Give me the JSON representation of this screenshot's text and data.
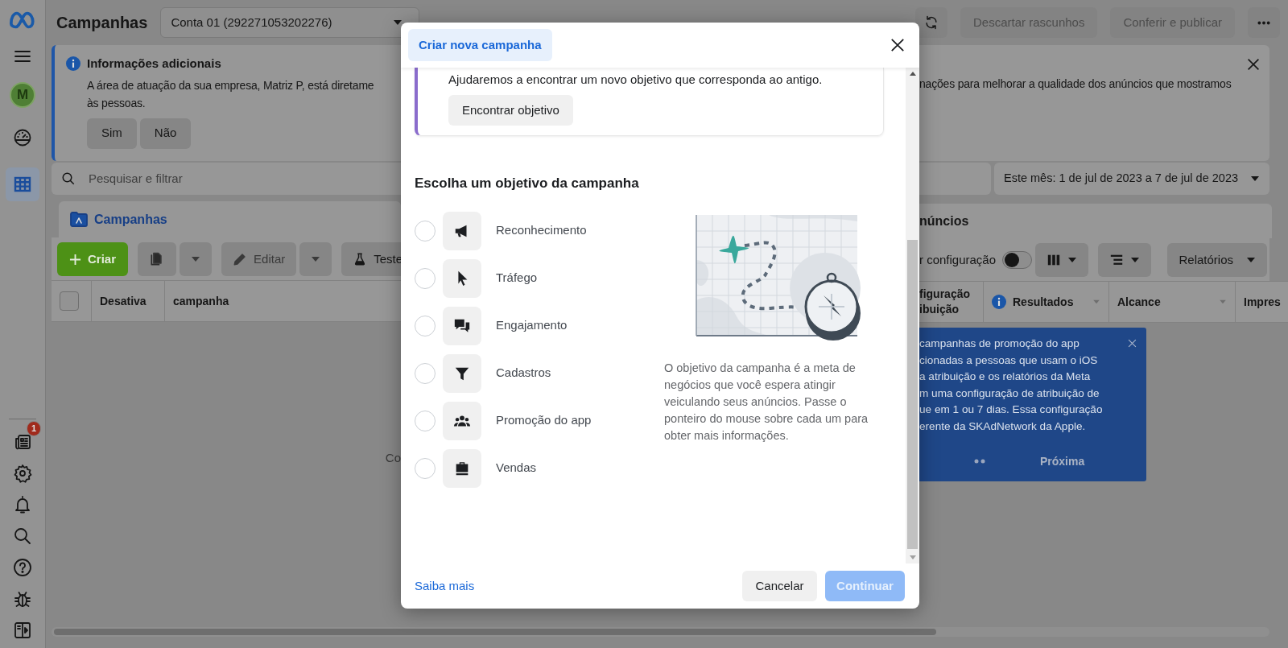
{
  "sidebar": {
    "avatar": "M",
    "nav": [
      {
        "kind": "gauge",
        "selected": false
      },
      {
        "kind": "table",
        "selected": true
      }
    ],
    "tools": [
      {
        "kind": "news",
        "badge": "1"
      },
      {
        "kind": "settings"
      },
      {
        "kind": "bell"
      },
      {
        "kind": "search"
      },
      {
        "kind": "help"
      },
      {
        "kind": "bug"
      },
      {
        "kind": "panel"
      }
    ]
  },
  "header": {
    "title": "Campanhas",
    "account": "Conta 01 (292271053202276)",
    "buttons": [
      "Descartar rascunhos",
      "Conferir e publicar"
    ]
  },
  "banner": {
    "title": "Informações adicionais",
    "text_left": [
      "A área de atuação da sua empresa, Matriz P, está diretame",
      "às pessoas."
    ],
    "text_right": "nações para melhorar a qualidade dos anúncios que mostramos",
    "buttons": [
      "Sim",
      "Não"
    ]
  },
  "search": {
    "placeholder": "Pesquisar e filtrar"
  },
  "date_range": "Este mês: 1 de jul de 2023 a 7 de jul de 2023",
  "tabs": [
    {
      "label": "Campanhas",
      "selected": true
    },
    {
      "label": "núncios",
      "selected": false
    }
  ],
  "toolbar": {
    "create": "Criar",
    "edit": "Editar",
    "test": "Teste",
    "setting_label": "r configuração",
    "setting_on": false,
    "reports": "Relatórios"
  },
  "table": {
    "select_all_checked": false,
    "columns_left": [
      {
        "label": "Desativa"
      },
      {
        "label": "campanha"
      }
    ],
    "columns_right": [
      {
        "lines": [
          "figuração",
          "ibuição"
        ],
        "info": false
      },
      {
        "lines": [
          "Resultados"
        ],
        "info": true
      },
      {
        "lines": [
          "Alcance"
        ],
        "info": false
      },
      {
        "lines": [
          "Impres"
        ],
        "info": false
      }
    ],
    "body_text": "Co"
  },
  "tooltip": {
    "lines": [
      "campanhas de promoção do app",
      "cionadas a pessoas que usam o iOS",
      "a atribuição e os relatórios da Meta",
      "m uma configuração de atribuição de",
      "ue em 1 ou 7 dias. Essa configuração",
      "erente da SKAdNetwork da Apple."
    ],
    "next": "Próxima"
  },
  "modal": {
    "title": "Criar nova campanha",
    "notice": {
      "text": "Ajudaremos a encontrar um novo objetivo que corresponda ao antigo.",
      "button": "Encontrar objetivo"
    },
    "heading": "Escolha um objetivo da campanha",
    "objectives": [
      {
        "label": "Reconhecimento",
        "kind": "megaphone",
        "selected": false
      },
      {
        "label": "Tráfego",
        "kind": "cursor",
        "selected": false
      },
      {
        "label": "Engajamento",
        "kind": "chat",
        "selected": false
      },
      {
        "label": "Cadastros",
        "kind": "funnel",
        "selected": false
      },
      {
        "label": "Promoção do app",
        "kind": "people",
        "selected": false
      },
      {
        "label": "Vendas",
        "kind": "bag",
        "selected": false
      }
    ],
    "description": "O objetivo da campanha é a meta de negócios que você espera atingir veiculando seus anúncios. Passe o ponteiro do mouse sobre cada um para obter mais informações.",
    "link": "Saiba mais",
    "buttons": [
      {
        "label": "Cancelar",
        "primary": false,
        "disabled": false
      },
      {
        "label": "Continuar",
        "primary": true,
        "disabled": true
      }
    ]
  }
}
